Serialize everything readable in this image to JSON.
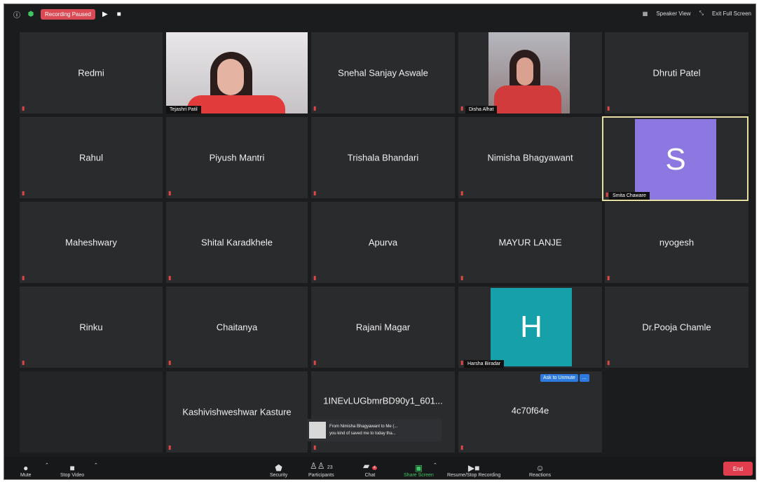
{
  "topbar": {
    "info_icon": "info-icon",
    "shield_icon": "shield-icon",
    "recording_status": "Recording Paused",
    "play_icon": "play-icon",
    "stop_icon": "stop-icon",
    "speaker_view": "Speaker View",
    "exit_full_screen": "Exit Full Screen"
  },
  "participants": [
    {
      "name": "Redmi"
    },
    {
      "name": "Tejashri Patil"
    },
    {
      "name": "Snehal Sanjay Aswale"
    },
    {
      "name": "Disha Alhat"
    },
    {
      "name": "Dhruti Patel"
    },
    {
      "name": "Rahul"
    },
    {
      "name": "Piyush Mantri"
    },
    {
      "name": "Trishala Bhandari"
    },
    {
      "name": "Nimisha Bhagyawant"
    },
    {
      "name": "Smita Chaware",
      "avatar": "S"
    },
    {
      "name": "Maheshwary"
    },
    {
      "name": "Shital Karadkhele"
    },
    {
      "name": "Apurva"
    },
    {
      "name": "MAYUR LANJE"
    },
    {
      "name": "nyogesh"
    },
    {
      "name": "Rinku"
    },
    {
      "name": "Chaitanya"
    },
    {
      "name": "Rajani Magar"
    },
    {
      "name": "Harsha Biradar",
      "avatar": "H"
    },
    {
      "name": "Dr.Pooja Chamle"
    },
    {
      "name": "Kashivishweshwar Kasture"
    },
    {
      "name": "1INEvLUGbmrBD90y1_601..."
    },
    {
      "name": "4c70f64e"
    }
  ],
  "ask_to_unmute": "Ask to Unmute",
  "more": "...",
  "toast": {
    "from": "From Nimisha Bhagyawant to Me (...",
    "message": "you kind of saved me to today tha..."
  },
  "toolbar": {
    "mute": "Mute",
    "stop_video": "Stop Video",
    "security": "Security",
    "participants": "Participants",
    "participants_count": "23",
    "chat": "Chat",
    "chat_badge": "4",
    "share_screen": "Share Screen",
    "recording": "Resume/Stop Recording",
    "reactions": "Reactions",
    "end": "End"
  },
  "colors": {
    "background": "#1b1c1e",
    "tile": "#2a2b2d",
    "recording": "#d94a55",
    "highlight": "#e5e0a1",
    "avatar_purple": "#8c78e0",
    "avatar_teal": "#16a0aa",
    "share_green": "#41c462",
    "end_red": "#e03e4d",
    "unmute_blue": "#2d7be0"
  }
}
